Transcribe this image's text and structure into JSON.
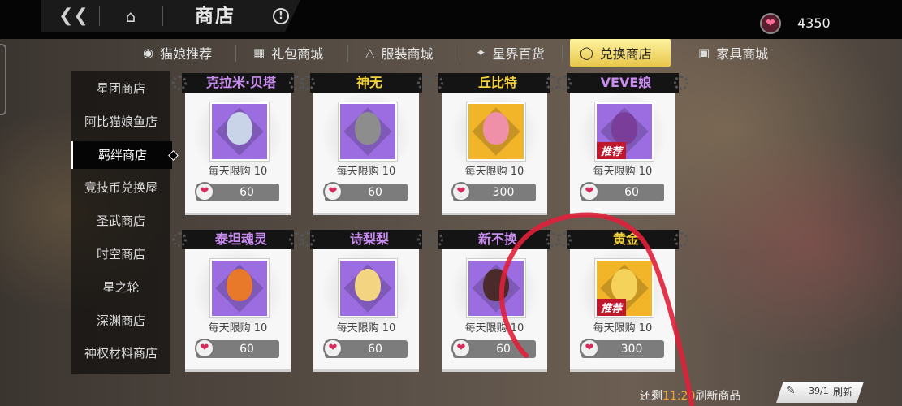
{
  "header": {
    "back_icon": "back-chevron-icon",
    "home_icon": "home-icon",
    "title": "商店",
    "info_icon": "info-icon",
    "info_symbol": "!"
  },
  "currency": {
    "icon": "heart-gem-icon",
    "amount": "4350"
  },
  "tabs": [
    {
      "label": "猫娘推荐",
      "icon": "paw-icon",
      "active": false
    },
    {
      "label": "礼包商城",
      "icon": "gift-icon",
      "active": false
    },
    {
      "label": "服装商城",
      "icon": "clothes-icon",
      "active": false
    },
    {
      "label": "星界百货",
      "icon": "star-drop-icon",
      "active": false
    },
    {
      "label": "兑换商店",
      "icon": "coin-icon",
      "active": true
    },
    {
      "label": "家具商城",
      "icon": "chair-icon",
      "active": false
    }
  ],
  "sidebar": {
    "items": [
      {
        "label": "星团商店",
        "active": false
      },
      {
        "label": "阿比猫娘鱼店",
        "active": false
      },
      {
        "label": "羁绊商店",
        "active": true
      },
      {
        "label": "竞技币兑换屋",
        "active": false
      },
      {
        "label": "圣武商店",
        "active": false
      },
      {
        "label": "时空商店",
        "active": false
      },
      {
        "label": "星之轮",
        "active": false
      },
      {
        "label": "深渊商店",
        "active": false
      },
      {
        "label": "神权材料商店",
        "active": false
      }
    ]
  },
  "items": [
    {
      "name": "克拉米·贝塔",
      "limit": "每天限购 10",
      "price": "60",
      "rarity": "purple",
      "recommend": ""
    },
    {
      "name": "神无",
      "limit": "每天限购 10",
      "price": "60",
      "rarity": "purple",
      "recommend": ""
    },
    {
      "name": "丘比特",
      "limit": "每天限购 10",
      "price": "300",
      "rarity": "gold",
      "recommend": ""
    },
    {
      "name": "VEVE娘",
      "limit": "每天限购 10",
      "price": "60",
      "rarity": "purple",
      "recommend": "推荐"
    },
    {
      "name": "泰坦魂灵",
      "limit": "每天限购 10",
      "price": "60",
      "rarity": "purple",
      "recommend": ""
    },
    {
      "name": "诗梨梨",
      "limit": "每天限购 10",
      "price": "60",
      "rarity": "purple",
      "recommend": ""
    },
    {
      "name": "新不换",
      "limit": "每天限购 10",
      "price": "60",
      "rarity": "purple",
      "recommend": ""
    },
    {
      "name": "黄金",
      "limit": "每天限购 10",
      "price": "300",
      "rarity": "gold",
      "recommend": "推荐"
    }
  ],
  "footer": {
    "remain_prefix": "还剩",
    "remain_time": "11:20",
    "refresh_text": "刷新商品",
    "refresh_count": "39/1",
    "refresh_label": "刷新"
  },
  "colors": {
    "purple": "#9b6de0",
    "gold": "#f2b52a",
    "accent_yellow": "#f3d23c",
    "price_heart": "#d72a5a",
    "annotation_red": "#e0203a"
  }
}
